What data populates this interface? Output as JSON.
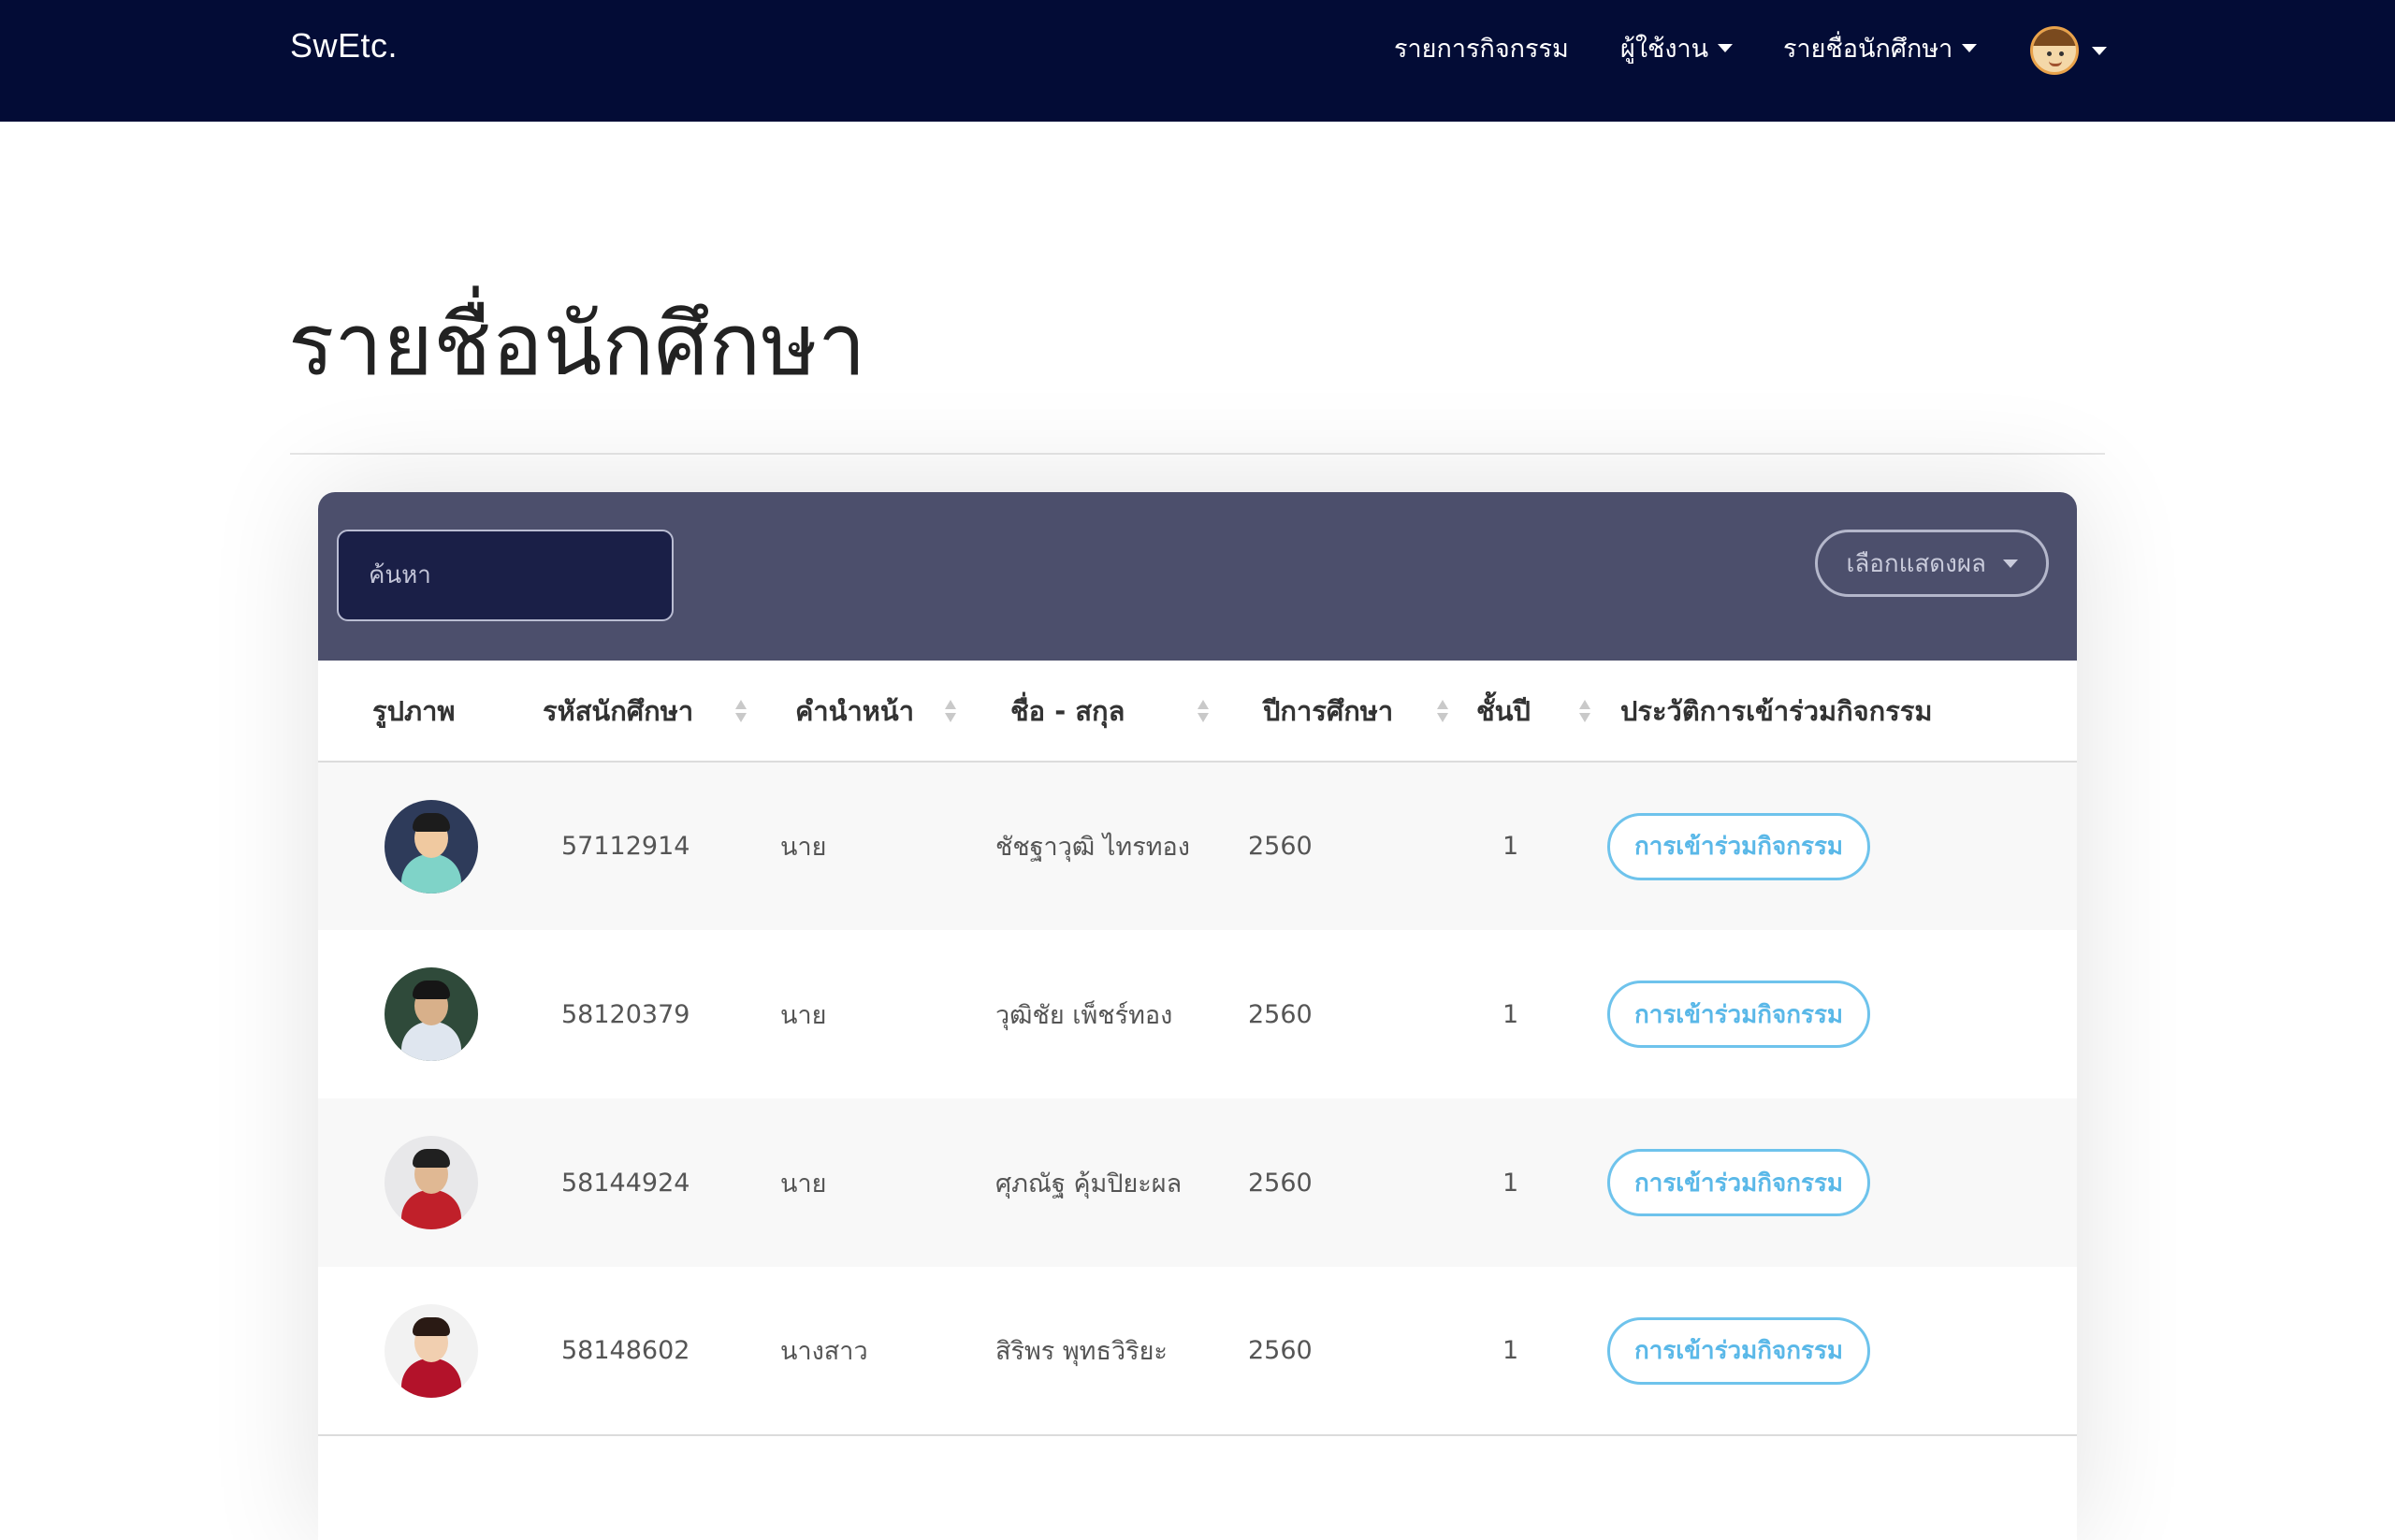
{
  "navbar": {
    "brand": "SwEtc.",
    "items": [
      {
        "label": "รายการกิจกรรม"
      },
      {
        "label": "ผู้ใช้งาน"
      },
      {
        "label": "รายชื่อนักศึกษา"
      }
    ],
    "avatar_icon": "user-avatar-icon"
  },
  "page": {
    "title": "รายชื่อนักศึกษา"
  },
  "toolbar": {
    "search_placeholder": "ค้นหา",
    "display_select_label": "เลือกแสดงผล"
  },
  "table": {
    "columns": [
      "รูปภาพ",
      "รหัสนักศึกษา",
      "คำนำหน้า",
      "ชื่อ - สกุล",
      "ปีการศึกษา",
      "ชั้นปี",
      "ประวัติการเข้าร่วมกิจกรรม"
    ],
    "rows": [
      {
        "student_id": "57112914",
        "prefix": "นาย",
        "name": "ชัชฐาวุฒิ ไทรทอง",
        "year": "2560",
        "level": "1",
        "action": "การเข้าร่วมกิจกรรม"
      },
      {
        "student_id": "58120379",
        "prefix": "นาย",
        "name": "วุฒิชัย เพ็ชร์ทอง",
        "year": "2560",
        "level": "1",
        "action": "การเข้าร่วมกิจกรรม"
      },
      {
        "student_id": "58144924",
        "prefix": "นาย",
        "name": "ศุภณัฐ คุ้มปิยะผล",
        "year": "2560",
        "level": "1",
        "action": "การเข้าร่วมกิจกรรม"
      },
      {
        "student_id": "58148602",
        "prefix": "นางสาว",
        "name": "สิริพร พุทธวิริยะ",
        "year": "2560",
        "level": "1",
        "action": "การเข้าร่วมกิจกรรม"
      }
    ]
  },
  "colors": {
    "navbar_bg": "#030c36",
    "card_header_bg": "#4c4f6c",
    "accent": "#5ab8e8"
  }
}
